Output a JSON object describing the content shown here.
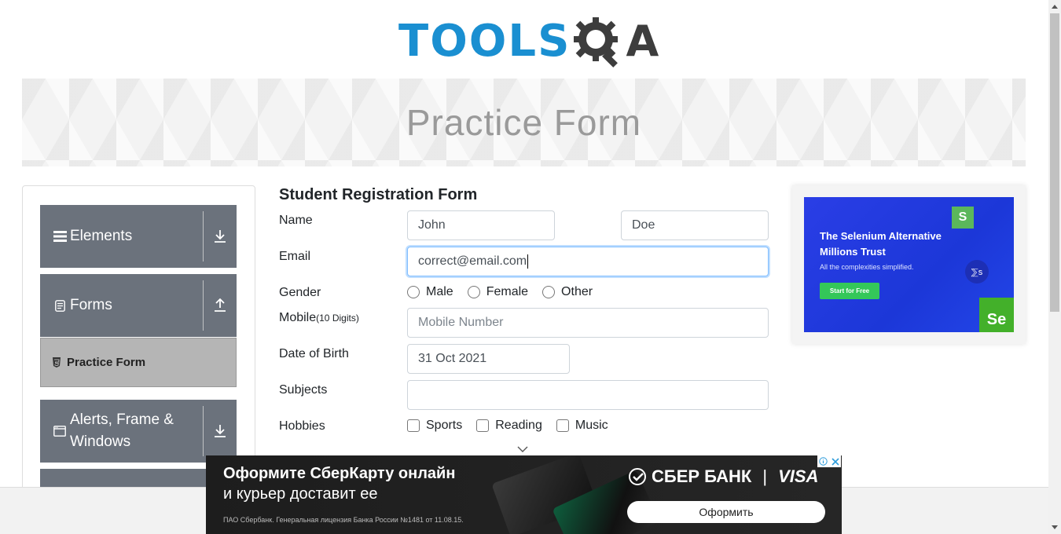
{
  "logo": {
    "text_main": "TOOLS",
    "text_end": "A"
  },
  "banner": {
    "title": "Practice Form"
  },
  "sidebar": {
    "groups": [
      {
        "label": "Elements"
      },
      {
        "label": "Forms"
      },
      {
        "label": "Alerts, Frame & Windows"
      }
    ],
    "active_item": "Practice Form"
  },
  "form": {
    "title": "Student Registration Form",
    "name_label": "Name",
    "first_name_value": "John",
    "last_name_value": "Doe",
    "email_label": "Email",
    "email_value": "correct@email.com",
    "gender_label": "Gender",
    "gender_options": [
      "Male",
      "Female",
      "Other"
    ],
    "mobile_label": "Mobile",
    "mobile_hint": "(10 Digits)",
    "mobile_placeholder": "Mobile Number",
    "dob_label": "Date of Birth",
    "dob_value": "31 Oct 2021",
    "subjects_label": "Subjects",
    "subjects_value": "",
    "hobbies_label": "Hobbies",
    "hobbies_options": [
      "Sports",
      "Reading",
      "Music"
    ]
  },
  "right_ad": {
    "headline": "The Selenium Alternative Millions Trust",
    "subline": "All the complexities simplified.",
    "button": "Start for Free",
    "badge_s": "S",
    "badge_se": "Se",
    "circle_text": "⅀s"
  },
  "bottom_ad": {
    "line1": "Оформите СберКарту онлайн",
    "line2": "и курьер доставит ее",
    "legal": "ПАО Сбербанк. Генеральная лицензия Банка России №1481 от 11.08.15.",
    "brand": "СБЕР БАНК",
    "brand_sep": "|",
    "brand_visa": "VISA",
    "button": "Оформить"
  },
  "colors": {
    "logo_blue": "#1a8fd1",
    "sidebar_group": "#6b727c",
    "sidebar_active": "#b5b5b5",
    "focus_border": "#80bdff"
  }
}
